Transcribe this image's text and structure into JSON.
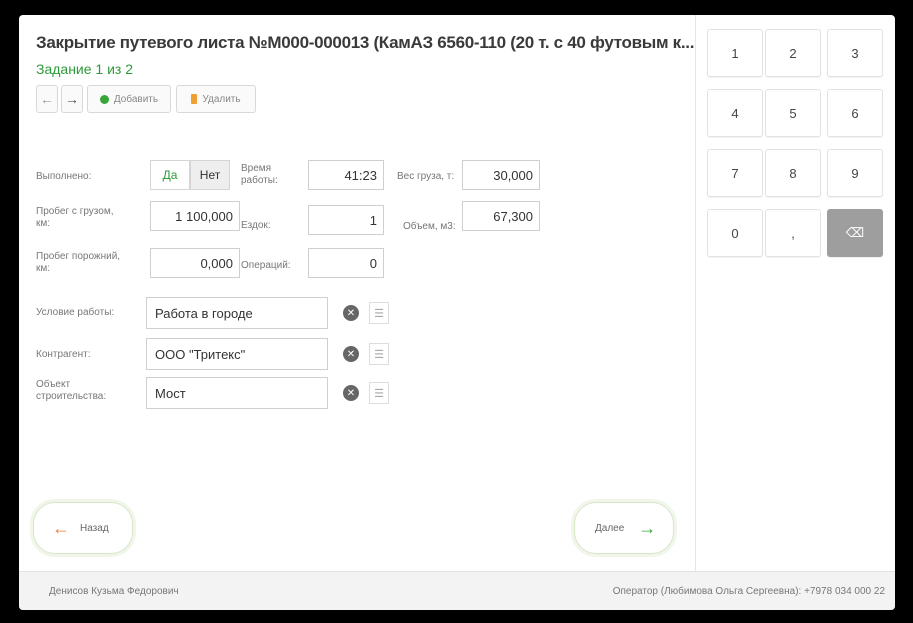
{
  "window": {
    "title": "Закрытие путевого листа №М000-000013 (КамАЗ 6560-110 (20 т. с 40 футовым к...",
    "subtitle": "Задание 1 из 2"
  },
  "toolbar": {
    "back_icon": "←",
    "forward_icon": "→",
    "add_label": "Добавить",
    "delete_label": "Удалить"
  },
  "form": {
    "done_label": "Выполнено:",
    "yes_label": "Да",
    "no_label": "Нет",
    "work_time_label": "Время работы:",
    "work_time_value": "41:23",
    "cargo_weight_label": "Вес груза, т:",
    "cargo_weight_value": "30,000",
    "loaded_mileage_label": "Пробег с грузом, км:",
    "loaded_mileage_value": "1 100,000",
    "trips_label": "Ездок:",
    "trips_value": "1",
    "volume_label": "Объем, м3:",
    "volume_value": "67,300",
    "empty_mileage_label": "Пробег порожний, км:",
    "empty_mileage_value": "0,000",
    "operations_label": "Операций:",
    "operations_value": "0",
    "work_condition_label": "Условие работы:",
    "work_condition_value": "Работа в городе",
    "counterparty_label": "Контрагент:",
    "counterparty_value": "ООО \"Тритекс\"",
    "construction_object_label": "Объект строительства:",
    "construction_object_value": "Мост"
  },
  "nav": {
    "back_label": "Назад",
    "next_label": "Далее"
  },
  "keypad": {
    "keys": [
      "1",
      "2",
      "3",
      "4",
      "5",
      "6",
      "7",
      "8",
      "9",
      "0",
      ","
    ],
    "backspace_icon": "⌫"
  },
  "footer": {
    "driver_name": "Денисов Кузьма Федорович",
    "operator_info": "Оператор (Любимова Ольга Сергеевна): +7978 034 000 22"
  },
  "colors": {
    "accent_green": "#2e9a3a",
    "next_arrow_green": "#3aa53a",
    "back_arrow_orange": "#f07a3a"
  }
}
